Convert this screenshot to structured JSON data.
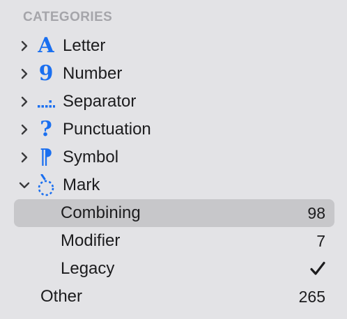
{
  "sidebar": {
    "section_title": "CATEGORIES",
    "categories": [
      {
        "label": "Letter",
        "icon": "letter-A-icon",
        "glyph": "A",
        "expanded": false
      },
      {
        "label": "Number",
        "icon": "digit-9-icon",
        "glyph": "9",
        "expanded": false
      },
      {
        "label": "Separator",
        "icon": "separator-dots-icon",
        "glyph": "",
        "expanded": false
      },
      {
        "label": "Punctuation",
        "icon": "question-mark-icon",
        "glyph": "?",
        "expanded": false
      },
      {
        "label": "Symbol",
        "icon": "pilcrow-icon",
        "glyph": "⁋",
        "expanded": false
      },
      {
        "label": "Mark",
        "icon": "combining-mark-dotted-circle-icon",
        "glyph": "",
        "expanded": true
      }
    ],
    "mark_children": [
      {
        "label": "Combining",
        "count": "98",
        "selected": true
      },
      {
        "label": "Modifier",
        "count": "7",
        "selected": false
      },
      {
        "label": "Legacy",
        "count": "",
        "checked": true,
        "selected": false
      }
    ],
    "other": {
      "label": "Other",
      "count": "265"
    }
  },
  "colors": {
    "background": "#e3e3e6",
    "accent": "#1a6ff0",
    "selection": "#c7c7ca",
    "header_text": "#a5a5aa",
    "text": "#1c1c1e"
  }
}
